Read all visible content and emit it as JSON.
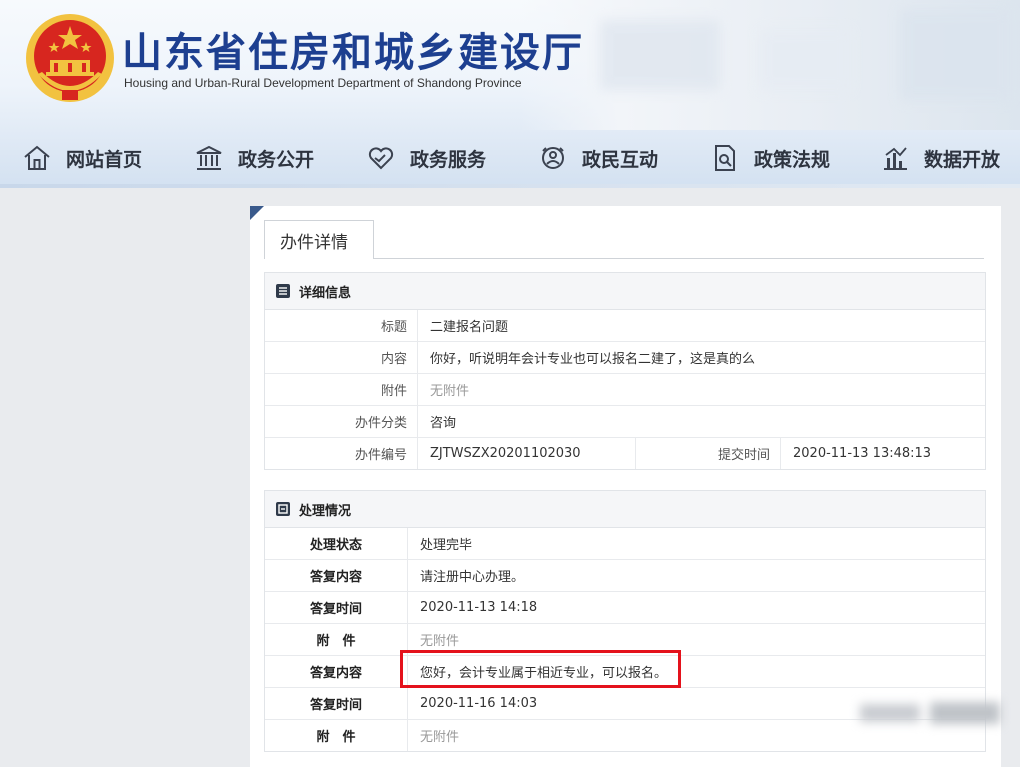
{
  "header": {
    "title": "山东省住房和城乡建设厅",
    "subtitle": "Housing and Urban-Rural Development Department of Shandong Province",
    "nav": [
      {
        "label": "网站首页",
        "icon": "home-icon"
      },
      {
        "label": "政务公开",
        "icon": "government-building-icon"
      },
      {
        "label": "政务服务",
        "icon": "handshake-heart-icon"
      },
      {
        "label": "政民互动",
        "icon": "interaction-icon"
      },
      {
        "label": "政策法规",
        "icon": "document-search-icon"
      },
      {
        "label": "数据开放",
        "icon": "bar-chart-icon"
      }
    ]
  },
  "panel": {
    "tab_label": "办件详情",
    "detail": {
      "heading": "详细信息",
      "rows": {
        "title_label": "标题",
        "title_value": "二建报名问题",
        "content_label": "内容",
        "content_value": "你好，听说明年会计专业也可以报名二建了，这是真的么",
        "attachment_label": "附件",
        "attachment_value": "无附件",
        "category_label": "办件分类",
        "category_value": "咨询",
        "number_label": "办件编号",
        "number_value": "ZJTWSZX20201102030",
        "submit_label": "提交时间",
        "submit_value": "2020-11-13 13:48:13"
      }
    },
    "processing": {
      "heading": "处理情况",
      "rows": [
        {
          "label": "处理状态",
          "value": "处理完毕",
          "muted": false
        },
        {
          "label": "答复内容",
          "value": "请注册中心办理。",
          "muted": false
        },
        {
          "label": "答复时间",
          "value": "2020-11-13 14:18",
          "muted": false
        },
        {
          "label": "附　件",
          "value": "无附件",
          "muted": true
        },
        {
          "label": "答复内容",
          "value": "您好，会计专业属于相近专业，可以报名。",
          "muted": false
        },
        {
          "label": "答复时间",
          "value": "2020-11-16 14:03",
          "muted": false
        },
        {
          "label": "附　件",
          "value": "无附件",
          "muted": true
        }
      ]
    }
  },
  "colors": {
    "title_blue": "#1d3f90",
    "highlight_red": "#e4121c",
    "corner_blue": "#3a5a8c",
    "emblem_red": "#d7261f",
    "emblem_gold": "#f2c240"
  }
}
